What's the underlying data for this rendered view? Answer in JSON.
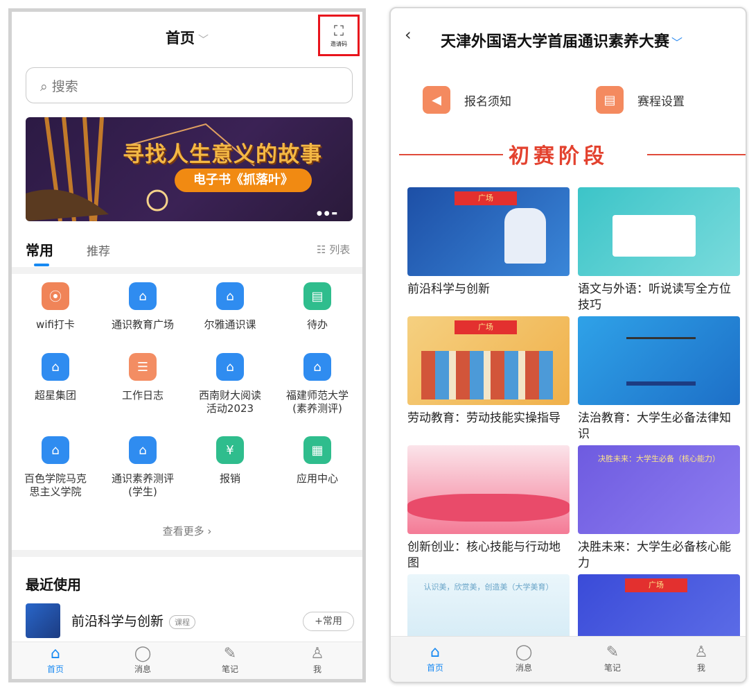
{
  "left": {
    "header": {
      "title": "首页",
      "invite_label": "邀请码"
    },
    "search": {
      "placeholder": "搜索"
    },
    "banner": {
      "title": "寻找人生意义的故事",
      "subtitle": "电子书《抓落叶》"
    },
    "tabs": [
      {
        "label": "常用"
      },
      {
        "label": "推荐"
      }
    ],
    "list_view_label": "列表",
    "apps": [
      {
        "label": "wifi打卡",
        "icon": "wifi-checkin-icon",
        "color": "#f08458"
      },
      {
        "label": "通识教育广场",
        "icon": "home-icon",
        "color": "#2f8cf0"
      },
      {
        "label": "尔雅通识课",
        "icon": "home-icon",
        "color": "#2f8cf0"
      },
      {
        "label": "待办",
        "icon": "todo-icon",
        "color": "#2fbd8d"
      },
      {
        "label": "超星集团",
        "icon": "home-icon",
        "color": "#2f8cf0"
      },
      {
        "label": "工作日志",
        "icon": "notebook-icon",
        "color": "#f38d63"
      },
      {
        "label": "西南财大阅读\n活动2023",
        "icon": "home-icon",
        "color": "#2f8cf0"
      },
      {
        "label": "福建师范大学\n(素养测评)",
        "icon": "home-icon",
        "color": "#2f8cf0"
      },
      {
        "label": "百色学院马克\n思主义学院",
        "icon": "home-icon",
        "color": "#2f8cf0"
      },
      {
        "label": "通识素养测评\n(学生)",
        "icon": "home-icon",
        "color": "#2f8cf0"
      },
      {
        "label": "报销",
        "icon": "money-bag-icon",
        "color": "#2fbd8d"
      },
      {
        "label": "应用中心",
        "icon": "apps-grid-icon",
        "color": "#2fbd8d"
      }
    ],
    "more_label": "查看更多",
    "recent": {
      "title": "最近使用",
      "item_name": "前沿科学与创新",
      "item_badge": "课程",
      "add_label": "+常用"
    },
    "bottom_nav": [
      {
        "label": "首页",
        "icon": "home-icon",
        "active": true
      },
      {
        "label": "消息",
        "icon": "message-icon",
        "active": false
      },
      {
        "label": "笔记",
        "icon": "note-icon",
        "active": false
      },
      {
        "label": "我",
        "icon": "person-icon",
        "active": false
      }
    ]
  },
  "right": {
    "header": {
      "title": "天津外国语大学首届通识素养大赛"
    },
    "actions": [
      {
        "label": "报名须知",
        "icon": "speaker-icon"
      },
      {
        "label": "赛程设置",
        "icon": "schedule-icon"
      }
    ],
    "stage_title": "初赛阶段",
    "cards": [
      {
        "title": "前沿科学与创新",
        "ribbon": "广场"
      },
      {
        "title": "语文与外语：听说读写全方位技巧",
        "ribbon": ""
      },
      {
        "title": "劳动教育：劳动技能实操指导",
        "ribbon": "广场"
      },
      {
        "title": "法治教育：大学生必备法律知识",
        "ribbon": ""
      },
      {
        "title": "创新创业：核心技能与行动地图",
        "ribbon": ""
      },
      {
        "title": "决胜未来：大学生必备核心能力",
        "ribbon": "",
        "image_text": "决胜未来：大学生必备（核心能力）"
      },
      {
        "title": "",
        "ribbon": "",
        "image_text": "认识美，欣赏美，创造美（大学美育）"
      },
      {
        "title": "",
        "ribbon": "广场"
      }
    ],
    "bottom_nav": [
      {
        "label": "首页",
        "icon": "home-icon",
        "active": true
      },
      {
        "label": "消息",
        "icon": "message-icon",
        "active": false
      },
      {
        "label": "笔记",
        "icon": "note-icon",
        "active": false
      },
      {
        "label": "我",
        "icon": "person-icon",
        "active": false
      }
    ]
  }
}
